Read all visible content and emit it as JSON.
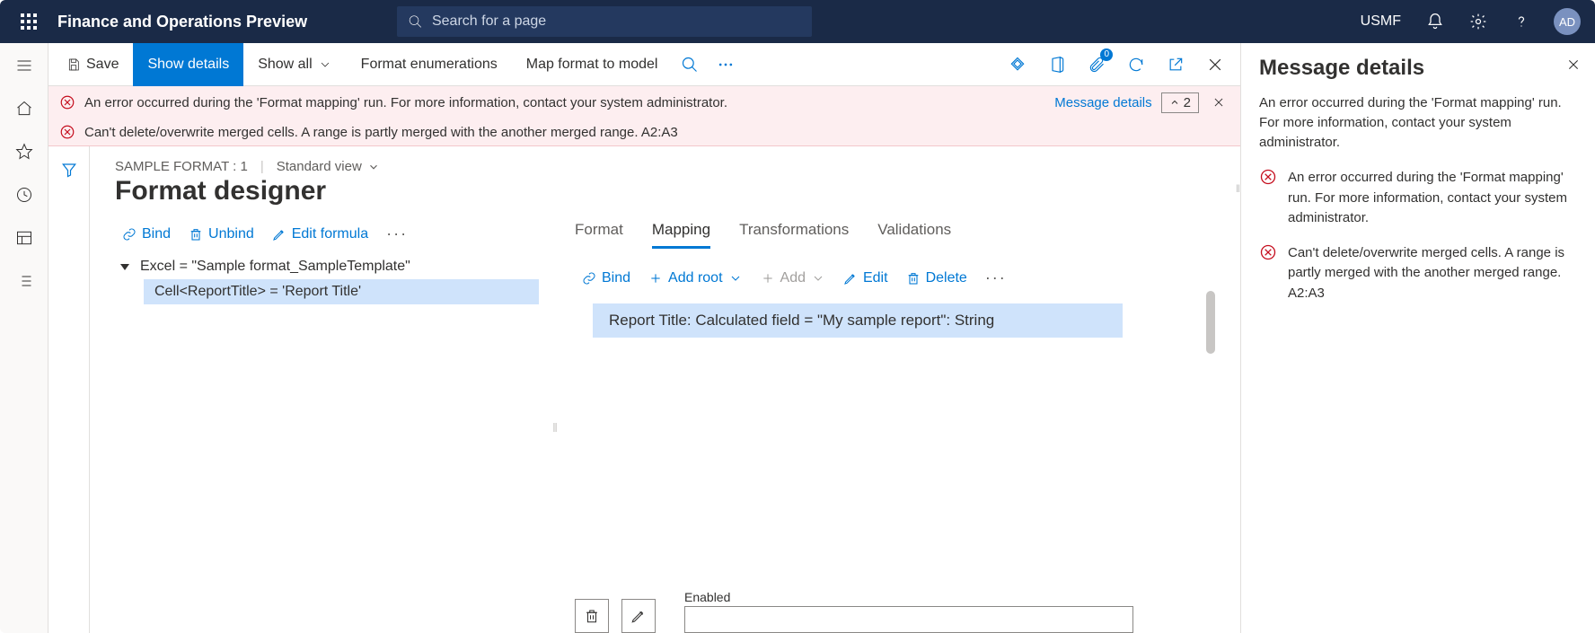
{
  "topbar": {
    "app_title": "Finance and Operations Preview",
    "search_placeholder": "Search for a page",
    "company": "USMF",
    "avatar": "AD"
  },
  "actionbar": {
    "save": "Save",
    "show_details": "Show details",
    "show_all": "Show all",
    "format_enum": "Format enumerations",
    "map_format": "Map format to model",
    "attach_badge": "0"
  },
  "messages": {
    "msg1": "An error occurred during the 'Format mapping' run. For more information, contact your system administrator.",
    "msg2": "Can't delete/overwrite merged cells. A range is partly merged with the another merged range. A2:A3",
    "details_link": "Message details",
    "count": "2"
  },
  "page": {
    "crumb": "SAMPLE FORMAT : 1",
    "view": "Standard view",
    "title": "Format designer"
  },
  "left_toolbar": {
    "bind": "Bind",
    "unbind": "Unbind",
    "edit_formula": "Edit formula"
  },
  "tree": {
    "root": "Excel = \"Sample format_SampleTemplate\"",
    "child": "Cell<ReportTitle> = 'Report Title'"
  },
  "tabs": {
    "format": "Format",
    "mapping": "Mapping",
    "transformations": "Transformations",
    "validations": "Validations"
  },
  "right_toolbar": {
    "bind": "Bind",
    "add_root": "Add root",
    "add": "Add",
    "edit": "Edit",
    "delete": "Delete"
  },
  "mapping_item": "Report Title: Calculated field = \"My sample report\": String",
  "bottom": {
    "enabled_label": "Enabled"
  },
  "side": {
    "title": "Message details",
    "summary": "An error occurred during the 'Format mapping' run. For more information, contact your system administrator.",
    "item1": "An error occurred during the 'Format mapping' run. For more information, contact your system administrator.",
    "item2": "Can't delete/overwrite merged cells. A range is partly merged with the another merged range. A2:A3"
  }
}
